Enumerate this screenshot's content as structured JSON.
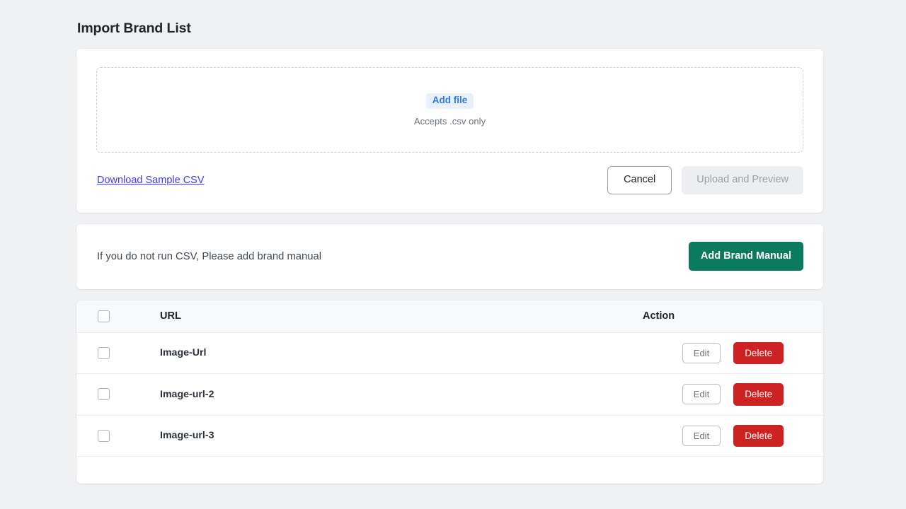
{
  "page": {
    "title": "Import Brand List",
    "background_color": "#f0f1f3"
  },
  "upload_card": {
    "dropzone": {
      "add_file_label": "Add file",
      "hint": "Accepts .csv only"
    },
    "download_sample_label": "Download Sample CSV",
    "cancel_label": "Cancel",
    "upload_label": "Upload and Preview",
    "accent_color": "#2a7ae4",
    "link_color": "#3b3bf2"
  },
  "manual_card": {
    "message": "If you do not run CSV, Please add brand manual",
    "button_label": "Add Brand Manual",
    "button_color": "#0c7a5e"
  },
  "table": {
    "headers": {
      "select_all": "",
      "url": "URL",
      "action": "Action"
    },
    "rows": [
      {
        "url": "Image-Url",
        "edit_label": "Edit",
        "delete_label": "Delete",
        "checked": false
      },
      {
        "url": "Image-url-2",
        "edit_label": "Edit",
        "delete_label": "Delete",
        "checked": false
      },
      {
        "url": "Image-url-3",
        "edit_label": "Edit",
        "delete_label": "Delete",
        "checked": false
      }
    ],
    "delete_color": "#cc2222",
    "header_background": "#f8f9fa"
  }
}
